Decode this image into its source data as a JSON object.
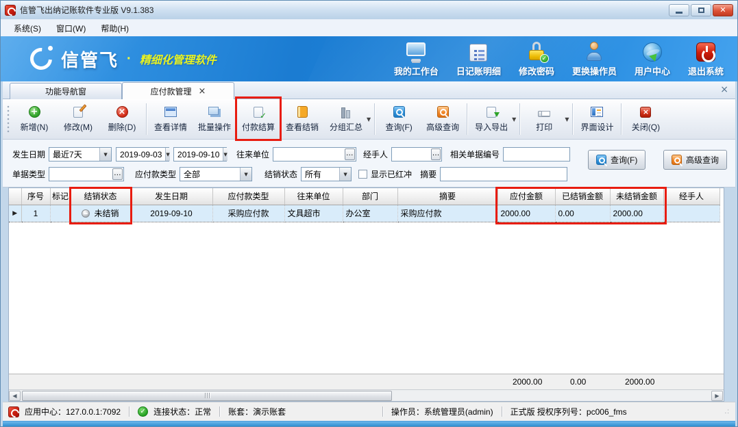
{
  "window": {
    "title": "信管飞出纳记账软件专业版 V9.1.383"
  },
  "menu": {
    "items": [
      {
        "label": "系统(S)"
      },
      {
        "label": "窗口(W)"
      },
      {
        "label": "帮助(H)"
      }
    ]
  },
  "banner": {
    "logo": "信管飞",
    "dot": "·",
    "tagline": "精细化管理软件",
    "actions": [
      {
        "label": "我的工作台",
        "icon": "monitor-icon"
      },
      {
        "label": "日记账明细",
        "icon": "ledger-icon"
      },
      {
        "label": "修改密码",
        "icon": "lock-check-icon"
      },
      {
        "label": "更换操作员",
        "icon": "user-icon"
      },
      {
        "label": "用户中心",
        "icon": "globe-icon"
      },
      {
        "label": "退出系统",
        "icon": "power-icon"
      }
    ]
  },
  "tabs": [
    {
      "label": "功能导航窗",
      "active": false
    },
    {
      "label": "应付款管理",
      "active": true,
      "close": "×"
    }
  ],
  "tabstrip_close": "×",
  "toolbar": {
    "buttons": [
      {
        "label": "新增(N)",
        "icon": "add-icon"
      },
      {
        "label": "修改(M)",
        "icon": "edit-icon"
      },
      {
        "label": "删除(D)",
        "icon": "delete-icon"
      },
      {
        "label": "查看详情",
        "icon": "details-icon"
      },
      {
        "label": "批量操作",
        "icon": "batch-icon"
      },
      {
        "label": "付款结算",
        "icon": "settle-check-icon",
        "highlighted": true
      },
      {
        "label": "查看结销",
        "icon": "book-icon"
      },
      {
        "label": "分组汇总",
        "icon": "group-summary-icon",
        "dropdown": true
      },
      {
        "label": "查询(F)",
        "icon": "search-blue-icon"
      },
      {
        "label": "高级查询",
        "icon": "search-orange-icon"
      },
      {
        "label": "导入导出",
        "icon": "import-export-icon",
        "dropdown": true
      },
      {
        "label": "打印",
        "icon": "print-icon",
        "dropdown": true
      },
      {
        "label": "界面设计",
        "icon": "ui-design-icon"
      },
      {
        "label": "关闭(Q)",
        "icon": "close-red-icon"
      }
    ],
    "dropdown_glyph": "▼"
  },
  "filters": {
    "date_label": "发生日期",
    "date_preset": "最近7天",
    "date_from": "2019-09-03",
    "date_to": "2019-09-10",
    "unit_label": "往来单位",
    "handler_label": "经手人",
    "related_label": "相关单据编号",
    "doctype_label": "单据类型",
    "paytype_label": "应付款类型",
    "paytype_value": "全部",
    "status_label": "结销状态",
    "status_value": "所有",
    "show_red_label": "显示已红冲",
    "summary_label": "摘要",
    "query_button": "查询(F)",
    "adv_query_button": "高级查询",
    "ellipsis": "…",
    "arrow": "▼"
  },
  "grid": {
    "columns": [
      "序号",
      "标记",
      "结销状态",
      "发生日期",
      "应付款类型",
      "往来单位",
      "部门",
      "摘要",
      "应付金额",
      "已结销金额",
      "未结销金额",
      "经手人"
    ],
    "row_pointer": "▶",
    "row": {
      "seq": "1",
      "mark": "",
      "status": "未结销",
      "date": "2019-09-10",
      "type": "采购应付款",
      "unit": "文具超市",
      "dept": "办公室",
      "summary": "采购应付款",
      "payable": "2000.00",
      "settled": "0.00",
      "unsettled": "2000.00",
      "handler": ""
    },
    "totals": {
      "payable": "2000.00",
      "settled": "0.00",
      "unsettled": "2000.00"
    },
    "scroll_left": "◀",
    "scroll_right": "▶"
  },
  "statusbar": {
    "app_center": "应用中心：127.0.0.1:7092",
    "connection": "连接状态：正常",
    "connection_check": "✓",
    "account": "账套：演示账套",
    "operator": "操作员：系统管理员(admin)",
    "license": "正式版 授权序列号：pc006_fms",
    "grip": ".:"
  },
  "colors": {
    "banner_blue": "#1e85dc",
    "tagline_yellow": "#e8f222",
    "annotation_red": "#e81c10",
    "selected_row_blue": "#d9ecfa",
    "close_button_red": "#d03018"
  },
  "badge_check": "✓"
}
